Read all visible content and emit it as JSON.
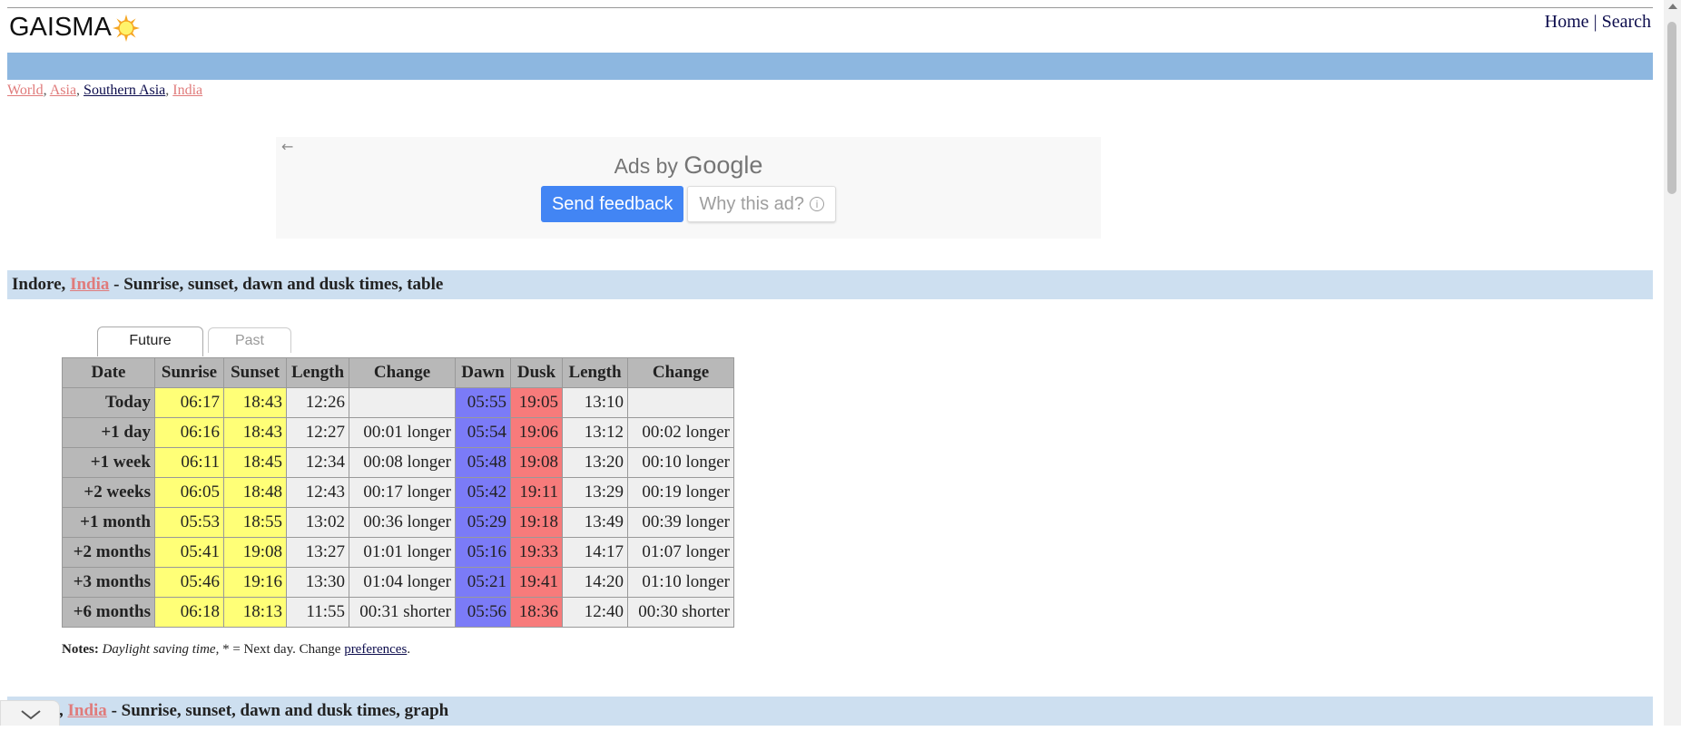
{
  "logo": {
    "text": "GAISMA",
    "icon": "sun-logo-icon"
  },
  "topnav": {
    "home": "Home",
    "separator": " | ",
    "search": "Search"
  },
  "breadcrumb": {
    "world": "World",
    "asia": "Asia",
    "southern_asia": "Southern Asia",
    "india": "India",
    "sep": ", "
  },
  "ad": {
    "back_icon": "arrow-left-icon",
    "ads_by": "Ads by",
    "google": "Google",
    "send_feedback": "Send feedback",
    "why_this_ad": "Why this ad?",
    "info_icon_glyph": "i"
  },
  "section1": {
    "city": "Indore, ",
    "country": "India",
    "title": " - Sunrise, sunset, dawn and dusk times, table"
  },
  "section2": {
    "prefix": ", ",
    "country": "India",
    "title": " - Sunrise, sunset, dawn and dusk times, graph"
  },
  "tabs": {
    "future": "Future",
    "past": "Past"
  },
  "table": {
    "headers": [
      "Date",
      "Sunrise",
      "Sunset",
      "Length",
      "Change",
      "Dawn",
      "Dusk",
      "Length",
      "Change"
    ],
    "rows": [
      [
        "Today",
        "06:17",
        "18:43",
        "12:26",
        "",
        "05:55",
        "19:05",
        "13:10",
        ""
      ],
      [
        "+1 day",
        "06:16",
        "18:43",
        "12:27",
        "00:01 longer",
        "05:54",
        "19:06",
        "13:12",
        "00:02 longer"
      ],
      [
        "+1 week",
        "06:11",
        "18:45",
        "12:34",
        "00:08 longer",
        "05:48",
        "19:08",
        "13:20",
        "00:10 longer"
      ],
      [
        "+2 weeks",
        "06:05",
        "18:48",
        "12:43",
        "00:17 longer",
        "05:42",
        "19:11",
        "13:29",
        "00:19 longer"
      ],
      [
        "+1 month",
        "05:53",
        "18:55",
        "13:02",
        "00:36 longer",
        "05:29",
        "19:18",
        "13:49",
        "00:39 longer"
      ],
      [
        "+2 months",
        "05:41",
        "19:08",
        "13:27",
        "01:01 longer",
        "05:16",
        "19:33",
        "14:17",
        "01:07 longer"
      ],
      [
        "+3 months",
        "05:46",
        "19:16",
        "13:30",
        "01:04 longer",
        "05:21",
        "19:41",
        "14:20",
        "01:10 longer"
      ],
      [
        "+6 months",
        "06:18",
        "18:13",
        "11:55",
        "00:31 shorter",
        "05:56",
        "18:36",
        "12:40",
        "00:30 shorter"
      ]
    ]
  },
  "notes": {
    "label": "Notes:",
    "dst": "Daylight saving time",
    "middle": ", * = Next day. Change ",
    "preferences": "preferences",
    "end": "."
  },
  "colors": {
    "sunrise_cell": "#ffff77",
    "dawn_cell": "#7b7bf7",
    "dusk_cell": "#f77b7b",
    "header_bar": "#8db7e0",
    "section_bar": "#cddff0",
    "link_red": "#e07b7b",
    "link_dark": "#0d0d4d"
  }
}
